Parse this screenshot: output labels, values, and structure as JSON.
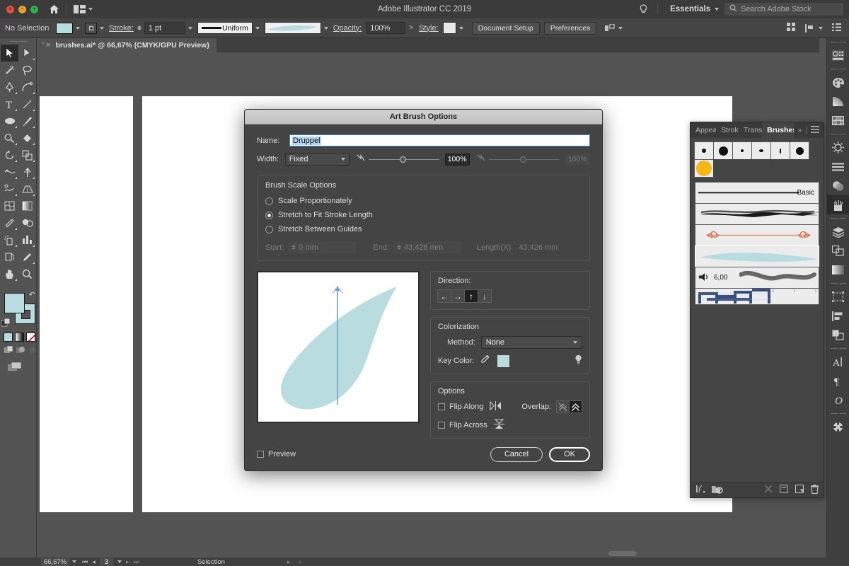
{
  "appbar": {
    "title": "Adobe Illustrator CC 2019",
    "home_icon": "home-icon",
    "arrange_icon": "arrange-documents-icon",
    "bulb_icon": "lightbulb-icon",
    "workspace": "Essentials",
    "search_placeholder": "Search Adobe Stock",
    "search_icon": "search-icon",
    "traffic": {
      "close": "close-window-button",
      "minimize": "minimize-window-button",
      "zoom": "maximize-window-button"
    }
  },
  "controlbar": {
    "selection_status": "No Selection",
    "fill_label": "fill-swatch",
    "stroke_label": "stroke-swatch",
    "stroke_text": "Stroke:",
    "stroke_weight": "1 pt",
    "profile": "Uniform",
    "brush_def": "art-brush-preview",
    "opacity_text": "Opacity:",
    "opacity_value": "100%",
    "style_text": "Style:",
    "document_setup": "Document Setup",
    "preferences": "Preferences"
  },
  "tab": {
    "close": "×",
    "title": "brushes.ai* @ 66,67% (CMYK/GPU Preview)"
  },
  "toolbar": {
    "tools": [
      {
        "name": "selection-tool",
        "selected": true
      },
      {
        "name": "direct-selection-tool",
        "selected": false
      },
      {
        "name": "magic-wand-tool",
        "selected": false
      },
      {
        "name": "lasso-tool",
        "selected": false
      },
      {
        "name": "pen-tool",
        "selected": false
      },
      {
        "name": "curvature-tool",
        "selected": false
      },
      {
        "name": "type-tool",
        "selected": false
      },
      {
        "name": "line-segment-tool",
        "selected": false
      },
      {
        "name": "ellipse-tool",
        "selected": false
      },
      {
        "name": "paintbrush-tool",
        "selected": false
      },
      {
        "name": "pencil-tool",
        "selected": false
      },
      {
        "name": "eraser-tool",
        "selected": false
      },
      {
        "name": "rotate-tool",
        "selected": false
      },
      {
        "name": "scale-tool",
        "selected": false
      },
      {
        "name": "width-tool",
        "selected": false
      },
      {
        "name": "free-transform-tool",
        "selected": false
      },
      {
        "name": "shape-builder-tool",
        "selected": false
      },
      {
        "name": "perspective-grid-tool",
        "selected": false
      },
      {
        "name": "mesh-tool",
        "selected": false
      },
      {
        "name": "gradient-tool",
        "selected": false
      },
      {
        "name": "eyedropper-tool",
        "selected": false
      },
      {
        "name": "blend-tool",
        "selected": false
      },
      {
        "name": "symbol-sprayer-tool",
        "selected": false
      },
      {
        "name": "column-graph-tool",
        "selected": false
      },
      {
        "name": "artboard-tool",
        "selected": false
      },
      {
        "name": "slice-tool",
        "selected": false
      },
      {
        "name": "hand-tool",
        "selected": false
      },
      {
        "name": "zoom-tool",
        "selected": false
      }
    ],
    "fill_color": "#b9ddde",
    "stroke_color": "#b9ddde",
    "swap_icon": "swap-fill-stroke-icon",
    "default_icon": "default-fill-stroke-icon",
    "color_modes": [
      "color-swatch",
      "gradient-swatch",
      "none-swatch"
    ],
    "draw_modes": [
      "draw-normal-icon",
      "draw-behind-icon",
      "draw-inside-icon"
    ],
    "screen_mode": "change-screen-mode-icon"
  },
  "dialog": {
    "title": "Art Brush Options",
    "name_label": "Name:",
    "name_value": "Druppel",
    "width_label": "Width:",
    "width_value": "Fixed",
    "width_pct": "100%",
    "width_pct2": "100%",
    "scale_group_title": "Brush Scale Options",
    "scale_options": [
      {
        "label": "Scale Proportionately",
        "selected": false
      },
      {
        "label": "Stretch to Fit Stroke Length",
        "selected": true
      },
      {
        "label": "Stretch Between Guides",
        "selected": false
      }
    ],
    "start_label": "Start:",
    "start_value": "0 mm",
    "end_label": "End:",
    "end_value": "43,426 mm",
    "length_label": "Length(X):",
    "length_value": "43,426 mm",
    "direction_label": "Direction:",
    "directions": [
      {
        "name": "direction-left",
        "glyph": "←",
        "active": false
      },
      {
        "name": "direction-right",
        "glyph": "→",
        "active": false
      },
      {
        "name": "direction-up",
        "glyph": "↑",
        "active": true
      },
      {
        "name": "direction-down",
        "glyph": "↓",
        "active": false
      }
    ],
    "colorization_title": "Colorization",
    "method_label": "Method:",
    "method_value": "None",
    "key_color_label": "Key Color:",
    "key_color": "#b9ddde",
    "eyedropper_icon": "eyedropper-icon",
    "tips_icon": "tips-lightbulb-icon",
    "options_title": "Options",
    "flip_along_label": "Flip Along",
    "flip_along_checked": false,
    "flip_across_label": "Flip Across",
    "flip_across_checked": false,
    "overlap_label": "Overlap:",
    "overlap_buttons": [
      {
        "name": "overlap-allow-button",
        "active": false
      },
      {
        "name": "overlap-prevent-button",
        "active": true
      }
    ],
    "preview_label": "Preview",
    "preview_checked": false,
    "cancel_label": "Cancel",
    "ok_label": "OK",
    "preview_shape_color": "#b9ddde",
    "preview_arrow_color": "#6e9ee0"
  },
  "panel": {
    "tabs": [
      {
        "label": "Appea",
        "active": false,
        "name": "tab-appearance"
      },
      {
        "label": "Strok",
        "active": false,
        "name": "tab-stroke"
      },
      {
        "label": "Trans",
        "active": false,
        "name": "tab-transform"
      },
      {
        "label": "Brushes",
        "active": true,
        "name": "tab-brushes"
      }
    ],
    "overflow_icon": "panel-overflow-icon",
    "menu_icon": "panel-menu-icon",
    "calligraphic_brushes": [
      {
        "name": "brush-3pt-round",
        "size": 6,
        "color": "#111111"
      },
      {
        "name": "brush-5pt-flat",
        "size": 13,
        "color": "#111111"
      },
      {
        "name": "brush-1pt-oval",
        "size": 4,
        "color": "#111111"
      },
      {
        "name": "brush-3pt-oval",
        "size": 5,
        "color": "#111111"
      },
      {
        "name": "brush-thin-line",
        "size": 2,
        "color": "#111111"
      },
      {
        "name": "brush-10pt-round",
        "size": 11,
        "color": "#111111"
      },
      {
        "name": "brush-yellow-dot",
        "size": 22,
        "color": "#f5b617"
      }
    ],
    "stroke_brushes": [
      {
        "name": "brush-basic",
        "label": "Basic",
        "style": "basic",
        "selected": false
      },
      {
        "name": "brush-charcoal",
        "label": "",
        "style": "charcoal",
        "selected": false
      },
      {
        "name": "brush-arrow",
        "label": "",
        "style": "arrow",
        "selected": false
      },
      {
        "name": "brush-druppel",
        "label": "",
        "style": "teardrop",
        "selected": true
      },
      {
        "name": "brush-pattern-wave",
        "label": "6,00",
        "style": "wave",
        "selected": false
      },
      {
        "name": "brush-pattern-border",
        "label": "",
        "style": "pattern",
        "selected": false
      }
    ],
    "wave_label": "6,00",
    "basic_label": "Basic",
    "footer_icons": [
      {
        "name": "brush-libraries-menu-icon"
      },
      {
        "name": "libraries-panel-icon"
      },
      {
        "name": "remove-brush-stroke-icon"
      },
      {
        "name": "options-of-selected-object-icon"
      },
      {
        "name": "new-brush-icon"
      },
      {
        "name": "delete-brush-icon"
      }
    ]
  },
  "rail": {
    "groups": [
      [
        {
          "name": "properties-panel-icon",
          "active": false
        }
      ],
      [
        {
          "name": "color-panel-icon",
          "active": false
        },
        {
          "name": "gradient-panel-icon",
          "active": false
        },
        {
          "name": "swatches-panel-icon",
          "active": false
        }
      ],
      [
        {
          "name": "stroke-panel-icon",
          "active": false
        },
        {
          "name": "stroke-weight-panel-icon",
          "active": false
        },
        {
          "name": "transparency-panel-icon",
          "active": false
        },
        {
          "name": "brushes-panel-icon",
          "active": true
        }
      ],
      [
        {
          "name": "layers-panel-icon",
          "active": false
        },
        {
          "name": "pathfinder-panel-icon",
          "active": false
        },
        {
          "name": "gradient-mesh-panel-icon",
          "active": false
        }
      ],
      [
        {
          "name": "artboards-panel-icon",
          "active": false
        },
        {
          "name": "align-panel-icon",
          "active": false
        },
        {
          "name": "transform-panel-icon",
          "active": false
        }
      ],
      [
        {
          "name": "character-panel-icon",
          "active": false
        },
        {
          "name": "paragraph-panel-icon",
          "active": false
        },
        {
          "name": "opentype-panel-icon",
          "active": false
        }
      ],
      [
        {
          "name": "symbols-panel-icon",
          "active": false
        }
      ]
    ]
  },
  "statusbar": {
    "zoom": "66,67%",
    "first_icon": "first-artboard-icon",
    "prev_icon": "previous-artboard-icon",
    "artboard_number": "3",
    "next_icon": "next-artboard-icon",
    "last_icon": "last-artboard-icon",
    "status_text": "Selection"
  }
}
